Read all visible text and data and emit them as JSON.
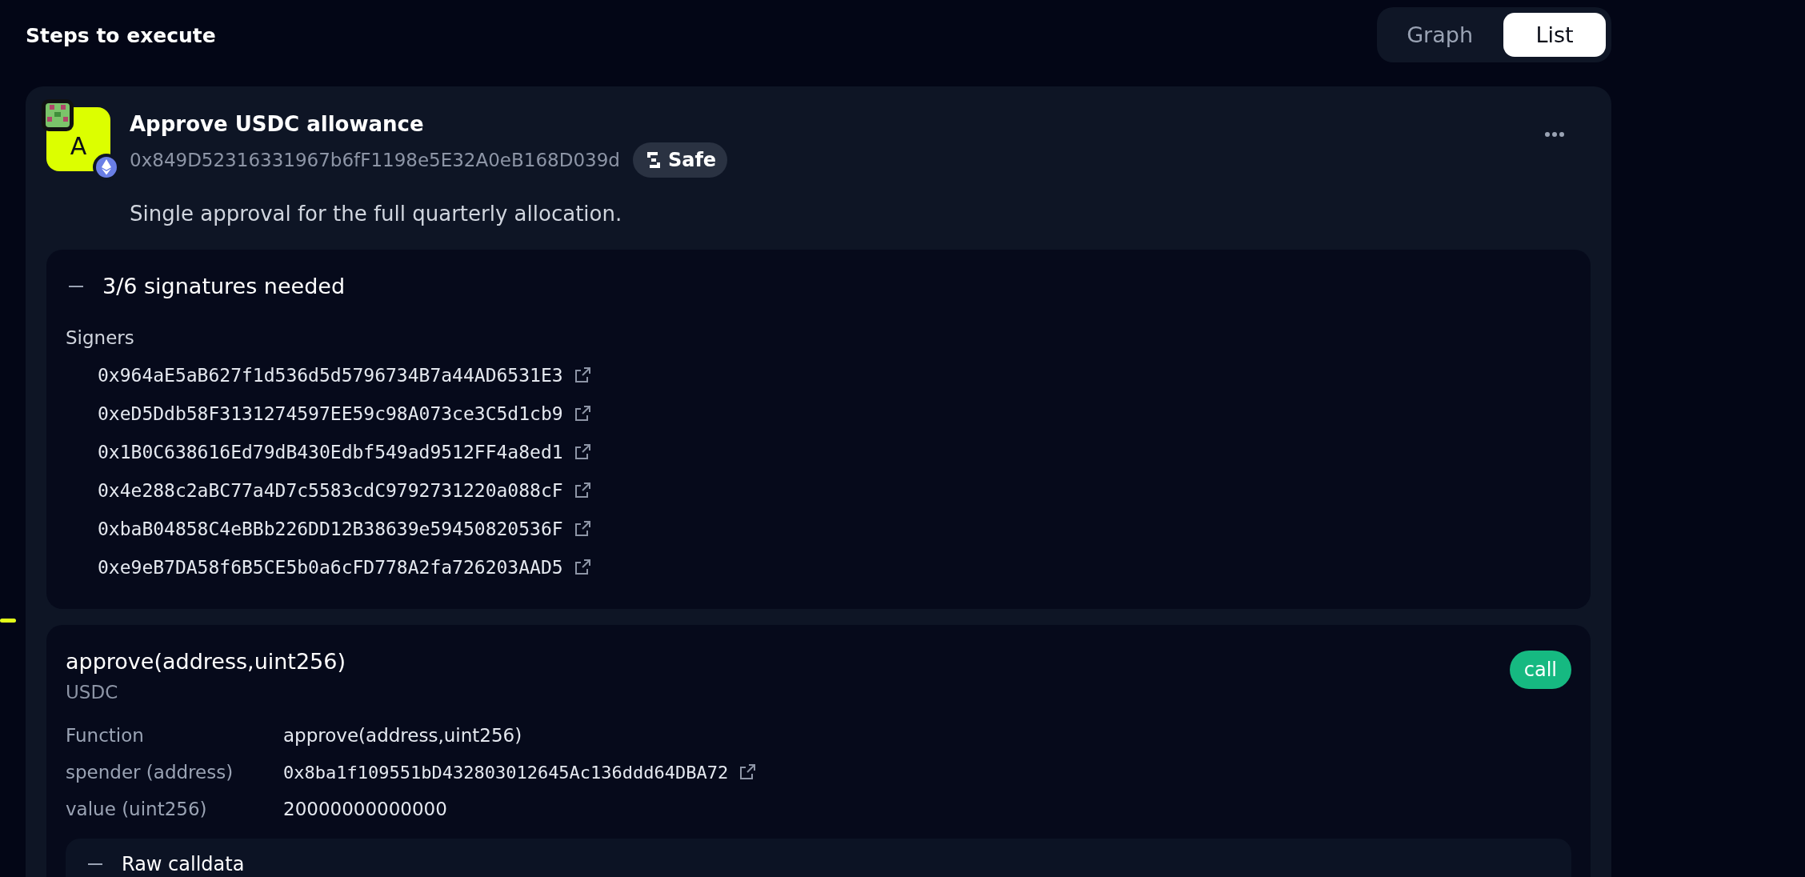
{
  "header": {
    "title": "Steps to execute"
  },
  "view_toggle": [
    {
      "label": "Graph",
      "selected": false
    },
    {
      "label": "List",
      "selected": true
    }
  ],
  "step": {
    "avatar_letter": "A",
    "title": "Approve USDC allowance",
    "address": "0x849D52316331967b6fF1198e5E32A0eB168D039d",
    "badge": "Safe",
    "description": "Single approval for the full quarterly allocation.",
    "signatures": {
      "expanded": true,
      "summary": "3/6 signatures needed",
      "signers_label": "Signers",
      "signers": [
        "0x964aE5aB627f1d536d5d5796734B7a44AD6531E3",
        "0xeD5Ddb58F3131274597EE59c98A073ce3C5d1cb9",
        "0x1B0C638616Ed79dB430Edbf549ad9512FF4a8ed1",
        "0x4e288c2aBC77a4D7c5583cdC9792731220a088cF",
        "0xbaB04858C4eBBb226DD12B38639e59450820536F",
        "0xe9eB7DA58f6B5CE5b0a6cFD778A2fa726203AAD5"
      ]
    },
    "call": {
      "signature": "approve(address,uint256)",
      "contract": "USDC",
      "tag": "call",
      "params": [
        {
          "kind": "text",
          "label": "Function",
          "value": "approve(address,uint256)"
        },
        {
          "kind": "address",
          "label": "spender (address)",
          "value": "0x8ba1f109551bD432803012645Ac136ddd64DBA72"
        },
        {
          "kind": "number",
          "label": "value (uint256)",
          "value": "20000000000000"
        }
      ],
      "raw": {
        "expanded": true,
        "label": "Raw calldata"
      }
    }
  }
}
